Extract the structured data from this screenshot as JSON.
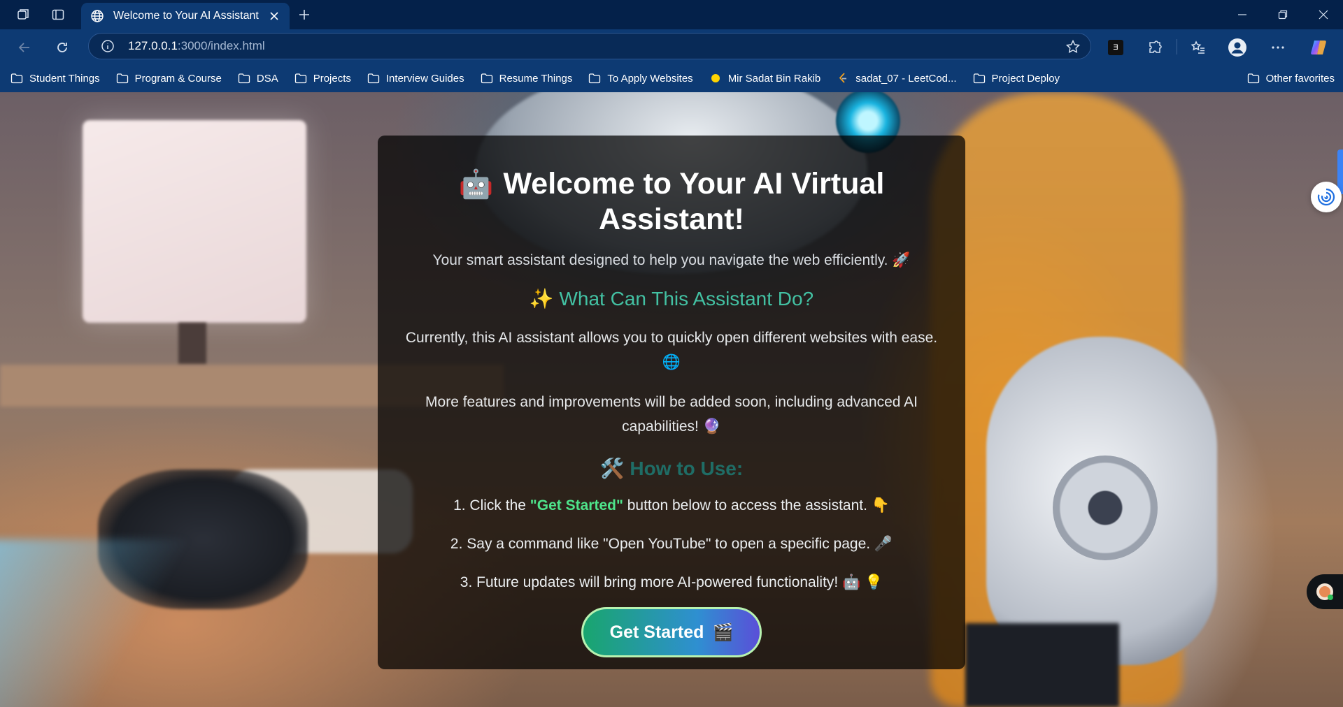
{
  "browser": {
    "tab": {
      "title": "Welcome to Your AI Assistant"
    },
    "address": {
      "host": "127.0.0.1",
      "path": ":3000/index.html"
    },
    "extension_label": "Ǝ",
    "bookmarks": [
      {
        "label": "Student Things",
        "icon": "folder-icon"
      },
      {
        "label": "Program & Course",
        "icon": "folder-icon"
      },
      {
        "label": "DSA",
        "icon": "folder-icon"
      },
      {
        "label": "Projects",
        "icon": "folder-icon"
      },
      {
        "label": "Interview Guides",
        "icon": "folder-icon"
      },
      {
        "label": "Resume Things",
        "icon": "folder-icon"
      },
      {
        "label": "To Apply Websites",
        "icon": "folder-icon"
      },
      {
        "label": "Mir Sadat Bin Rakib",
        "icon": "yellow-dot-icon"
      },
      {
        "label": "sadat_07 - LeetCod...",
        "icon": "leetcode-icon"
      },
      {
        "label": "Project Deploy",
        "icon": "folder-icon"
      }
    ],
    "other_favorites": "Other favorites"
  },
  "page": {
    "title_emoji": "🤖",
    "title": "Welcome to Your AI Virtual Assistant!",
    "lead": "Your smart assistant designed to help you navigate the web efficiently. 🚀",
    "section1_title": "✨ What Can This Assistant Do?",
    "para1": "Currently, this AI assistant allows you to quickly open different websites with ease. 🌐",
    "para2": "More features and improvements will be added soon, including advanced AI capabilities! 🔮",
    "section2_title": "🛠️ How to Use:",
    "step1_prefix": "1. Click the ",
    "step1_highlight": "\"Get Started\"",
    "step1_suffix": " button below to access the assistant. 👇",
    "step2": "2. Say a command like \"Open YouTube\" to open a specific page. 🎤",
    "step3": "3. Future updates will bring more AI-powered functionality! 🤖 💡",
    "cta_label": "Get Started",
    "cta_emoji": "🎬"
  },
  "colors": {
    "chrome_dark": "#04214a",
    "chrome": "#0d3a73",
    "accent_teal": "#43c1a3",
    "accent_green": "#4ee48b"
  }
}
